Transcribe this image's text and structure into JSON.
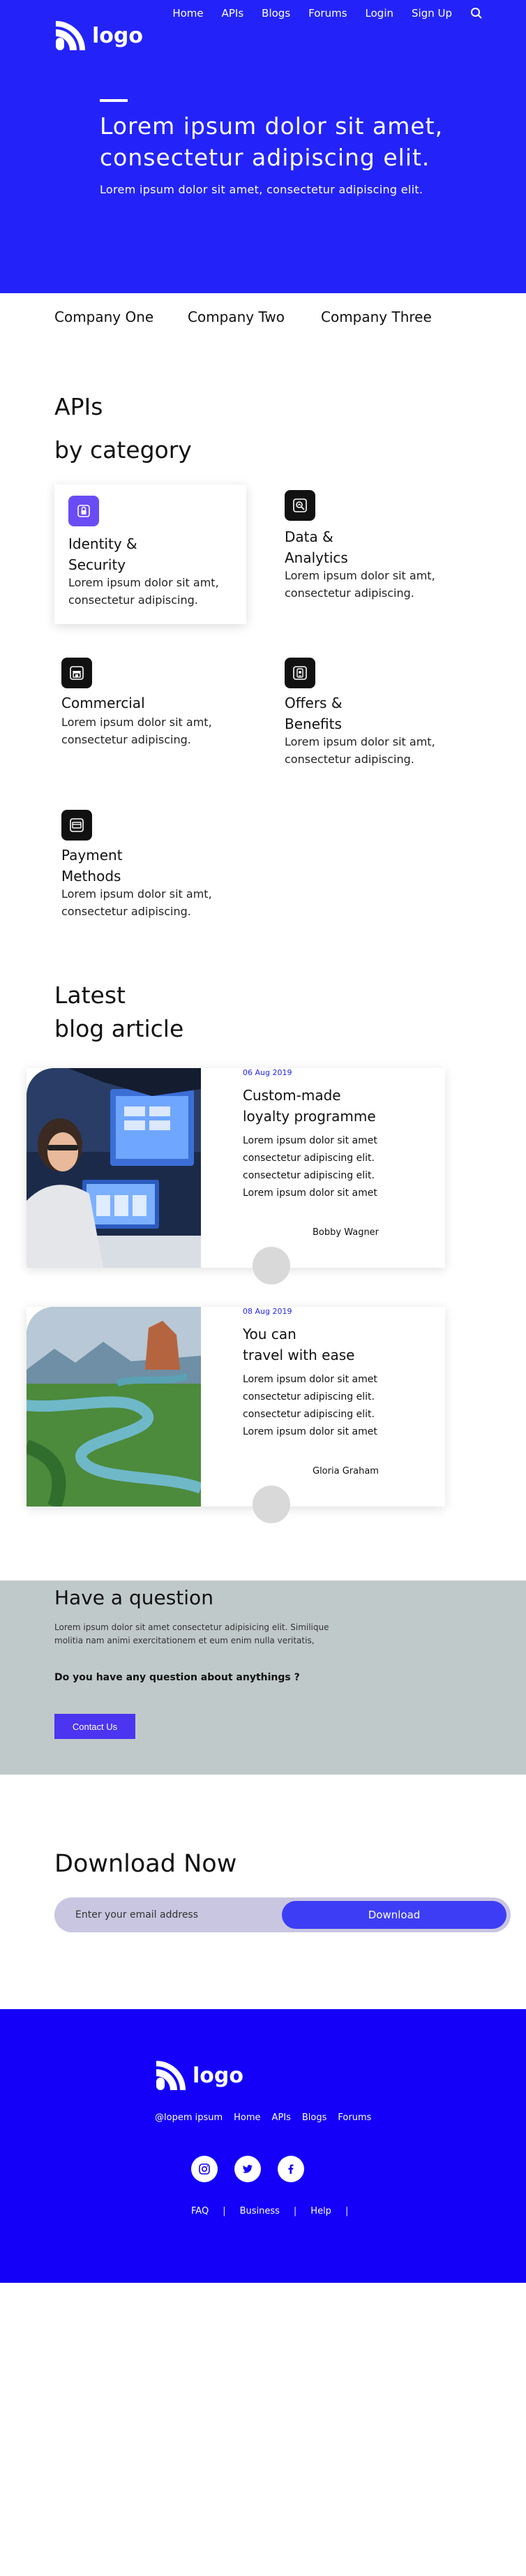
{
  "header": {
    "logo_text": "logo",
    "nav": [
      "Home",
      "APIs",
      "Blogs",
      "Forums",
      "Login",
      "Sign Up"
    ],
    "title_line1": "Lorem ipsum dolor sit amet,",
    "title_line2": "consectetur adipiscing elit.",
    "subtitle": "Lorem ipsum dolor sit amet, consectetur adipiscing elit."
  },
  "companies": [
    "Company One",
    "Company Two",
    "Company Three"
  ],
  "apis": {
    "title_line1": "APIs",
    "title_line2": "by category",
    "cards": [
      {
        "icon": "lock-icon",
        "title_line1": "Identity &",
        "title_line2": "Security",
        "desc_line1": "Lorem ipsum dolor sit amt,",
        "desc_line2": "consectetur adipiscing."
      },
      {
        "icon": "analytics-icon",
        "title_line1": "Data &",
        "title_line2": "Analytics",
        "desc_line1": "Lorem ipsum dolor sit amt,",
        "desc_line2": "consectetur adipiscing."
      },
      {
        "icon": "store-icon",
        "title_line1": "Commercial",
        "title_line2": "",
        "desc_line1": "Lorem ipsum dolor sit amt,",
        "desc_line2": "consectetur adipiscing."
      },
      {
        "icon": "mobile-offer-icon",
        "title_line1": "Offers &",
        "title_line2": "Benefits",
        "desc_line1": "Lorem ipsum dolor sit amt,",
        "desc_line2": "consectetur adipiscing."
      },
      {
        "icon": "card-icon",
        "title_line1": "Payment",
        "title_line2": "Methods",
        "desc_line1": "Lorem ipsum dolor sit amt,",
        "desc_line2": "consectetur adipiscing."
      }
    ]
  },
  "blog": {
    "title_line1": "Latest",
    "title_line2": "blog article",
    "articles": [
      {
        "date": "06 Aug 2019",
        "title_line1": "Custom-made",
        "title_line2": "loyalty programme",
        "body": [
          "Lorem ipsum dolor sit amet",
          "consectetur adipiscing elit.",
          "consectetur adipiscing elit.",
          "Lorem ipsum dolor sit amet"
        ],
        "author": "Bobby Wagner"
      },
      {
        "date": "08 Aug 2019",
        "title_line1": "You can",
        "title_line2": "travel with ease",
        "body": [
          "Lorem ipsum dolor sit amet",
          "consectetur adipiscing elit.",
          "consectetur adipiscing elit.",
          "Lorem ipsum dolor sit amet"
        ],
        "author": "Gloria Graham"
      }
    ]
  },
  "question": {
    "title": "Have a question",
    "body": "Lorem ipsum dolor sit amet consectetur adipisicing elit. Similique molitia nam animi exercitationem et eum enim nulla veritatis,",
    "ask": "Do you have any question about anythings ?",
    "button": "Contact Us"
  },
  "download": {
    "title_bold": "Download",
    "title_rest": " Now",
    "placeholder": "Enter your email address",
    "button": "Download"
  },
  "footer": {
    "logo_text": "logo",
    "links": [
      "@lopem ipsum",
      "Home",
      "APIs",
      "Blogs",
      "Forums"
    ],
    "bottom_links": [
      "FAQ",
      "Business",
      "Help"
    ],
    "separator": "|"
  },
  "colors": {
    "brand": "#2323f9",
    "footer": "#1400f8",
    "accent": "#4b35f0"
  }
}
